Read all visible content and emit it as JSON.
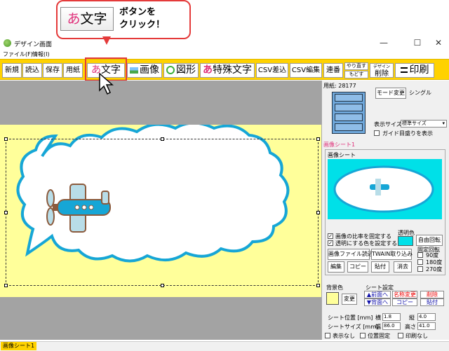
{
  "callout": {
    "button_kana": "あ",
    "button_label": "文字",
    "instruction_line1": "ボタンを",
    "instruction_line2": "クリック！"
  },
  "window": {
    "title": "デザイン画面",
    "minimize": "—",
    "maximize": "☐",
    "close": "✕"
  },
  "menu": [
    "ファイル(F)",
    "情報(I)"
  ],
  "toolbar": {
    "new": "新規",
    "open": "読込",
    "save": "保存",
    "paper": "用紙",
    "text_kana": "あ",
    "text": "文字",
    "image": "画像",
    "shape": "図形",
    "special_kana": "あ",
    "special": "特殊文字",
    "csv_insert": "CSV差込",
    "csv_edit": "CSV編集",
    "serial": "連番",
    "redo": "やり直す",
    "undo": "もどす",
    "design": "デザイン",
    "delete": "削除",
    "print": "印刷"
  },
  "right_panel": {
    "paper_label": "用紙: 28177",
    "mode_change": "モード変更",
    "mode_value": "シングル",
    "display_size_label": "表示サイズ",
    "display_size_value": "標準サイズ",
    "guide_scale": "ガイド目盛りを表示",
    "sheet_header": "画像シート1",
    "image_sheet_group": "画像シート",
    "keep_ratio": "画像の比率を固定する",
    "set_transparent": "透明にする色を設定する",
    "transparent_color": "透明色",
    "free_rotate": "自由回転",
    "load_image_file": "画像ファイル読込",
    "twain": "TWAIN取り込み",
    "fixed_rotate": "固定回転",
    "rot90": "90度",
    "rot180": "180度",
    "rot270": "270度",
    "edit": "編集",
    "copy": "コピー",
    "paste": "貼付",
    "erase": "消去",
    "bg_color": "背景色",
    "change": "変更",
    "sheet_settings": "シート設定",
    "to_front": "▲前面へ",
    "to_back": "▼背面へ",
    "rename": "名称変更",
    "sheet_copy": "コピー",
    "sheet_delete": "削除",
    "sheet_paste": "貼付",
    "sheet_pos": "シート位置 [mm]",
    "horizontal": "横",
    "horizontal_value": "1.8",
    "vertical": "縦",
    "vertical_value": "4.0",
    "sheet_size": "シートサイズ [mm]",
    "width": "幅",
    "width_value": "86.0",
    "height": "高さ",
    "height_value": "41.0",
    "hidden": "表示なし",
    "pos_fixed": "位置固定",
    "no_print": "印刷なし"
  },
  "status": {
    "tab": "画像シート1"
  },
  "colors": {
    "accent_yellow": "#ffd200",
    "sheet_yellow": "#ffff9a",
    "cyan": "#00e0e8",
    "highlight_red": "#e43a3a",
    "cloud_blue": "#16a6d6"
  }
}
